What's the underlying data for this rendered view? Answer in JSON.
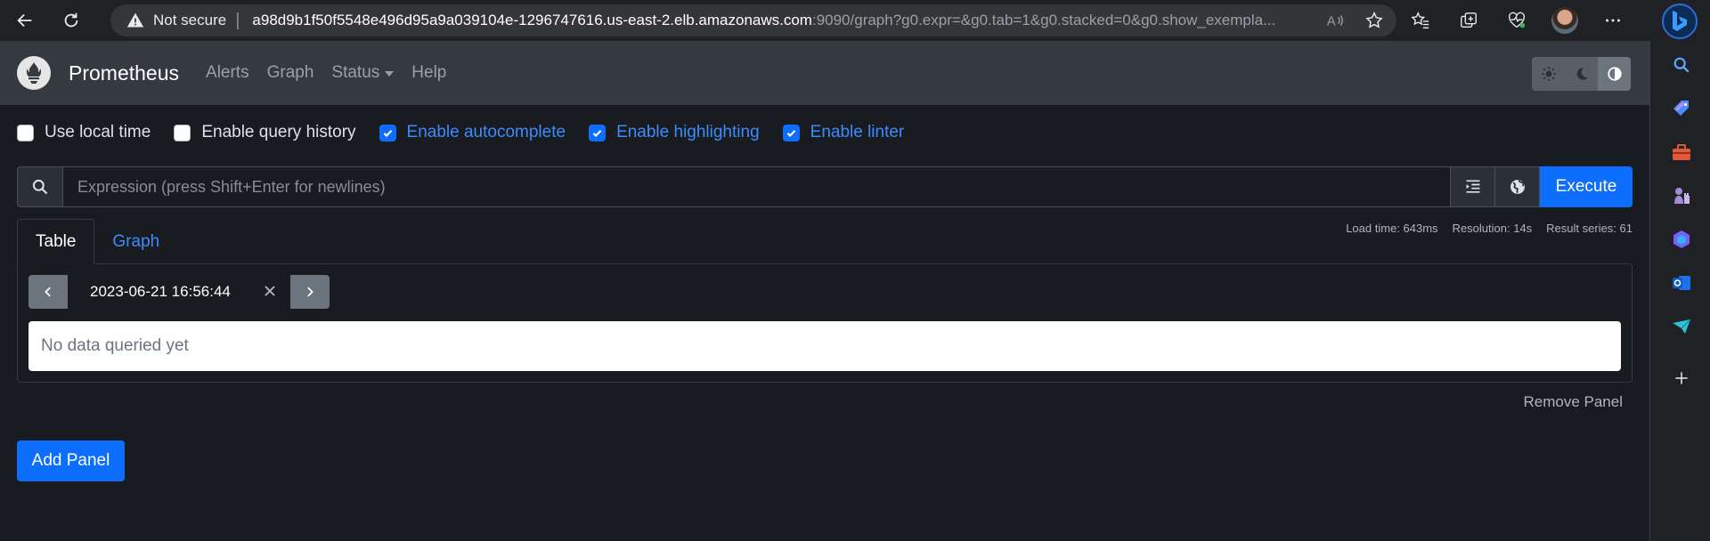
{
  "browser": {
    "not_secure": "Not secure",
    "url_host": "a98d9b1f50f5548e496d95a9a039104e-1296747616.us-east-2.elb.amazonaws.com",
    "url_path": ":9090/graph?g0.expr=&g0.tab=1&g0.stacked=0&g0.show_exempla..."
  },
  "navbar": {
    "brand": "Prometheus",
    "links": [
      "Alerts",
      "Graph",
      "Status",
      "Help"
    ]
  },
  "options": [
    {
      "label": "Use local time",
      "checked": false
    },
    {
      "label": "Enable query history",
      "checked": false
    },
    {
      "label": "Enable autocomplete",
      "checked": true
    },
    {
      "label": "Enable highlighting",
      "checked": true
    },
    {
      "label": "Enable linter",
      "checked": true
    }
  ],
  "expression": {
    "placeholder": "Expression (press Shift+Enter for newlines)",
    "value": "",
    "execute_label": "Execute"
  },
  "tabs": {
    "table": "Table",
    "graph": "Graph",
    "active": "Table"
  },
  "stats": {
    "load_time": "Load time: 643ms",
    "resolution": "Resolution: 14s",
    "result_series": "Result series: 61"
  },
  "panel": {
    "time_value": "2023-06-21 16:56:44",
    "no_data": "No data queried yet",
    "remove_label": "Remove Panel"
  },
  "add_panel_label": "Add Panel",
  "colors": {
    "accent": "#0d6efd",
    "navbar": "#343a40",
    "background": "#181b1f"
  }
}
